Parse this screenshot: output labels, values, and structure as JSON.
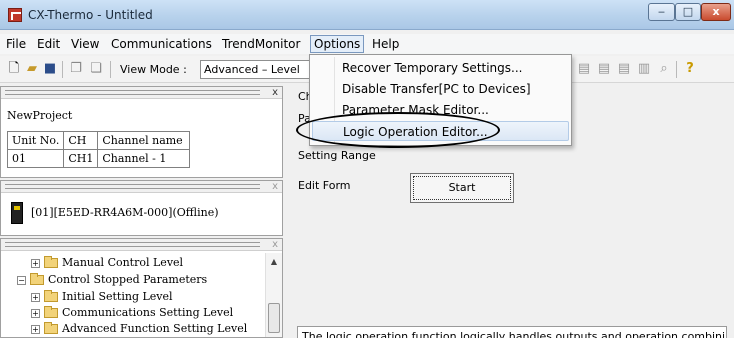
{
  "window": {
    "title": "CX-Thermo - Untitled",
    "min": "‒",
    "max": "□",
    "close": "x"
  },
  "menu": [
    "File",
    "Edit",
    "View",
    "Communications",
    "TrendMonitor",
    "Options",
    "Help"
  ],
  "toolbar": {
    "view_mode_label": "View Mode :",
    "view_mode_value": "Advanced – Level"
  },
  "project": {
    "name": "NewProject",
    "table_headers": [
      "Unit No.",
      "CH",
      "Channel name"
    ],
    "rows": [
      [
        "01",
        "CH1",
        "Channel - 1"
      ]
    ]
  },
  "device": {
    "label": "[01][E5ED-RR4A6M-000](Offline)"
  },
  "tree": [
    "Manual Control Level",
    "Control Stopped Parameters",
    "Initial Setting Level",
    "Communications Setting Level",
    "Advanced Function Setting Level"
  ],
  "right": {
    "ch_label": "Ch",
    "pa_label": "Pa",
    "setting_range": "Setting Range",
    "edit_form": "Edit Form",
    "start_button": "Start",
    "description": "The logic operation function logically handles outputs and operation combining the"
  },
  "options_menu": [
    "Recover Temporary Settings...",
    "Disable Transfer[PC to Devices]",
    "Parameter Mask Editor...",
    "Logic Operation Editor..."
  ],
  "highlight_color": "#000000"
}
